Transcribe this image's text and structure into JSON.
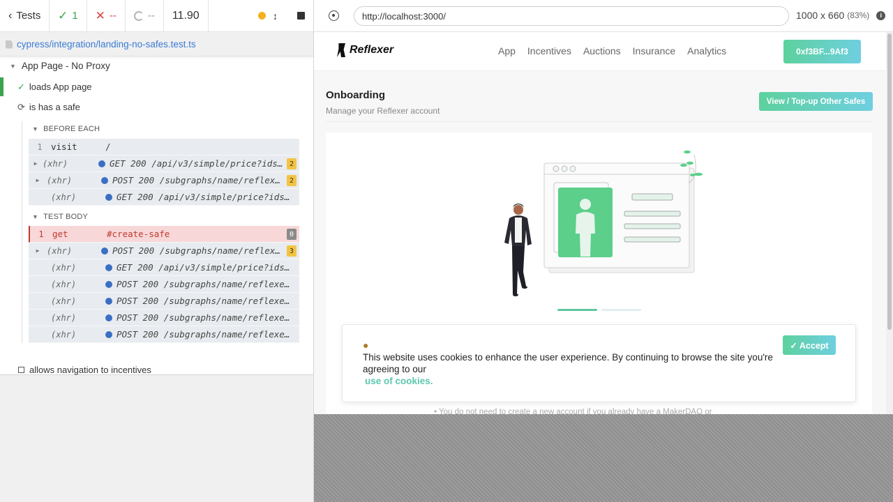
{
  "reporter": {
    "back_label": "Tests",
    "passed": "1",
    "failed": "--",
    "pending": "--",
    "duration": "11.90",
    "spec_path": "cypress/integration/landing-no-safes.test.ts",
    "suite_title": "App Page - No Proxy",
    "tests": [
      {
        "title": "loads App page",
        "state": "passed"
      },
      {
        "title": "is has a safe",
        "state": "running"
      },
      {
        "title": "allows navigation to incentives",
        "state": "pending"
      }
    ],
    "before_each": {
      "title": "BEFORE EACH",
      "commands": [
        {
          "num": "1",
          "name": "visit",
          "message": "/",
          "badge": ""
        },
        {
          "num": "",
          "name": "(xhr)",
          "message": "GET 200 /api/v3/simple/price?ids=ethereum&vs_currencies=usd",
          "badge": "2"
        },
        {
          "num": "",
          "name": "(xhr)",
          "message": "POST 200 /subgraphs/name/reflexer-labs/rai-mainnet",
          "badge": "2"
        },
        {
          "num": "",
          "name": "(xhr)",
          "message": "GET 200 /api/v3/simple/price?ids=ethereum&vs_currencies=usd",
          "badge": ""
        }
      ]
    },
    "test_body": {
      "title": "TEST BODY",
      "commands": [
        {
          "num": "1",
          "name": "get",
          "message": "#create-safe",
          "badge": "0"
        },
        {
          "num": "",
          "name": "(xhr)",
          "message": "POST 200 /subgraphs/name/reflexer-labs/rai-mainnet",
          "badge": "3"
        },
        {
          "num": "",
          "name": "(xhr)",
          "message": "GET 200 /api/v3/simple/price?ids=ethereum&vs_currencies=usd",
          "badge": ""
        },
        {
          "num": "",
          "name": "(xhr)",
          "message": "POST 200 /subgraphs/name/reflexer-labs/rai-mainnet",
          "badge": ""
        },
        {
          "num": "",
          "name": "(xhr)",
          "message": "POST 200 /subgraphs/name/reflexer-labs/rai-mainnet",
          "badge": ""
        },
        {
          "num": "",
          "name": "(xhr)",
          "message": "POST 200 /subgraphs/name/reflexer-labs/rai-mainnet",
          "badge": ""
        },
        {
          "num": "",
          "name": "(xhr)",
          "message": "POST 200 /subgraphs/name/reflexer-labs/rai-mainnet",
          "badge": ""
        }
      ]
    }
  },
  "aut": {
    "url": "http://localhost:3000/",
    "viewport": "1000 x 660",
    "scale": "(83%)",
    "app": {
      "logo_text": "Reflexer",
      "nav_links": [
        "App",
        "Incentives",
        "Auctions",
        "Insurance",
        "Analytics"
      ],
      "wallet_label": "0xf3BF...9Af3",
      "page_title": "Onboarding",
      "page_subtitle": "Manage your Reflexer account",
      "topup_label": "View / Top-up Other Safes",
      "bottom_text": "You do not need to create a new account if you already have a MakerDAO or",
      "cookie": {
        "text": "This website uses cookies to enhance the user experience. By continuing to browse the site you're agreeing to our",
        "link": "use of cookies.",
        "accept_label": "✓ Accept"
      }
    }
  },
  "colors": {
    "pass": "#3ba34d",
    "fail": "#e04545",
    "accent_gradient_start": "#5dd19e",
    "accent_gradient_end": "#6fcfe0",
    "xhr_dot": "#3b6fc4"
  }
}
